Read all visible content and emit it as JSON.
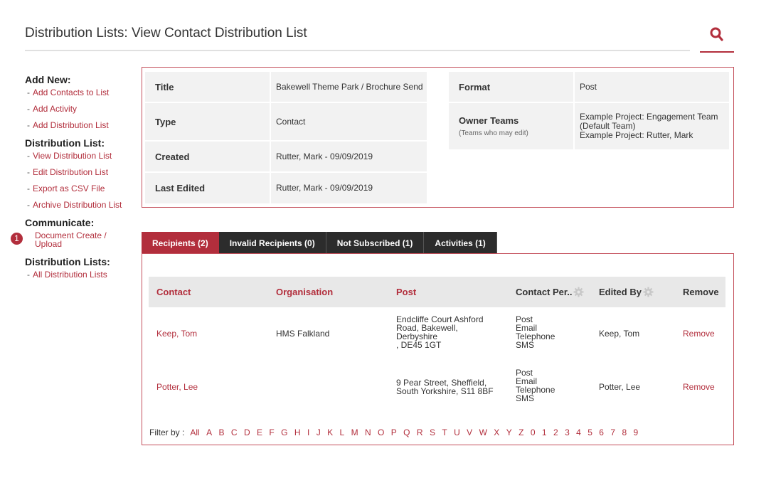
{
  "page": {
    "title": "Distribution Lists: View Contact Distribution List",
    "accent_color": "#b22e3c",
    "search_icon": "search-icon"
  },
  "sidebar": {
    "add_new": {
      "heading": "Add New:",
      "items": [
        "Add Contacts to List",
        "Add Activity",
        "Add Distribution List"
      ]
    },
    "distribution_list": {
      "heading": "Distribution List:",
      "items": [
        "View Distribution List",
        "Edit Distribution List",
        "Export as CSV File",
        "Archive Distribution List"
      ]
    },
    "communicate": {
      "heading": "Communicate:",
      "badge": "1",
      "items": [
        "Document Create / Upload"
      ]
    },
    "distribution_lists": {
      "heading": "Distribution Lists:",
      "items": [
        "All Distribution Lists"
      ]
    },
    "dash": "-"
  },
  "info": {
    "title_label": "Title",
    "title_value": "Bakewell Theme Park / Brochure Send",
    "type_label": "Type",
    "type_value": "Contact",
    "created_label": "Created",
    "created_value": "Rutter, Mark - 09/09/2019",
    "edited_label": "Last Edited",
    "edited_value": "Rutter, Mark - 09/09/2019",
    "format_label": "Format",
    "format_value": "Post",
    "owner_label": "Owner Teams",
    "owner_sub": "(Teams who may edit)",
    "owner_value_1": "Example Project: Engagement Team (Default Team)",
    "owner_value_2": "Example Project: Rutter, Mark"
  },
  "tabs": [
    {
      "label": "Recipients (2)",
      "active": true
    },
    {
      "label": "Invalid Recipients (0)",
      "active": false
    },
    {
      "label": "Not Subscribed (1)",
      "active": false
    },
    {
      "label": "Activities (1)",
      "active": false
    }
  ],
  "table": {
    "headers": {
      "contact": "Contact",
      "organisation": "Organisation",
      "post": "Post",
      "contact_per": "Contact Per..",
      "edited_by": "Edited By",
      "remove": "Remove"
    },
    "rows": [
      {
        "contact": "Keep, Tom",
        "organisation": "HMS Falkland",
        "post_lines": [
          "Endcliffe Court Ashford",
          "Road, Bakewell,",
          "Derbyshire",
          ", DE45 1GT"
        ],
        "contact_per": [
          "Post",
          "Email",
          "Telephone",
          "SMS"
        ],
        "edited_by": "Keep, Tom",
        "remove": "Remove"
      },
      {
        "contact": "Potter, Lee",
        "organisation": "",
        "post_lines": [
          "9 Pear Street, Sheffield,",
          "South Yorkshire, S11 8BF"
        ],
        "contact_per": [
          "Post",
          "Email",
          "Telephone",
          "SMS"
        ],
        "edited_by": "Potter, Lee",
        "remove": "Remove"
      }
    ]
  },
  "filter": {
    "label": "Filter by :",
    "options": [
      "All",
      "A",
      "B",
      "C",
      "D",
      "E",
      "F",
      "G",
      "H",
      "I",
      "J",
      "K",
      "L",
      "M",
      "N",
      "O",
      "P",
      "Q",
      "R",
      "S",
      "T",
      "U",
      "V",
      "W",
      "X",
      "Y",
      "Z",
      "0",
      "1",
      "2",
      "3",
      "4",
      "5",
      "6",
      "7",
      "8",
      "9"
    ]
  }
}
